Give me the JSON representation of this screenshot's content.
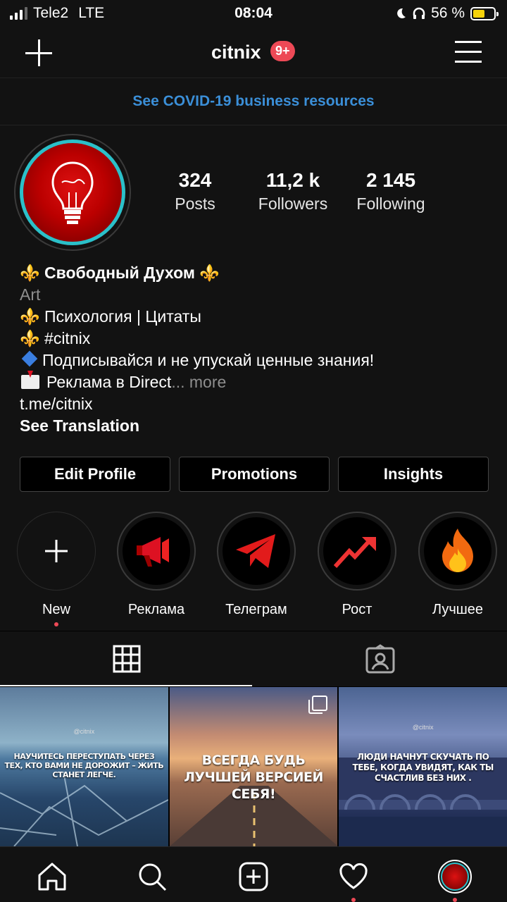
{
  "status_bar": {
    "carrier": "Tele2",
    "network": "LTE",
    "time": "08:04",
    "battery_percent": "56 %",
    "battery_level": 0.56
  },
  "header": {
    "username": "citnix",
    "notification_badge": "9+"
  },
  "banner": {
    "text": "See COVID-19 business resources"
  },
  "stats": [
    {
      "value": "324",
      "label": "Posts"
    },
    {
      "value": "11,2 k",
      "label": "Followers"
    },
    {
      "value": "2 145",
      "label": "Following"
    }
  ],
  "bio": {
    "fleur": "⚜️",
    "name": "Свободный Духом",
    "category": "Art",
    "line1": "Психология | Цитаты",
    "line2": "#citnix",
    "line3": "Подписывайся и не упускай ценные знания!",
    "line4": "Реклама в Direct",
    "ellipsis": "...",
    "more": "more",
    "link": "t.me/citnix",
    "see_translation": "See Translation"
  },
  "buttons": {
    "edit_profile": "Edit Profile",
    "promotions": "Promotions",
    "insights": "Insights"
  },
  "highlights": [
    {
      "label": "New"
    },
    {
      "label": "Реклама"
    },
    {
      "label": "Телеграм"
    },
    {
      "label": "Рост"
    },
    {
      "label": "Лучшее"
    }
  ],
  "posts": [
    {
      "watermark": "@citnix",
      "caption": "НАУЧИТЕСЬ ПЕРЕСТУПАТЬ ЧЕРЕЗ ТЕХ, КТО ВАМИ НЕ ДОРОЖИТ – ЖИТЬ СТАНЕТ ЛЕГЧЕ."
    },
    {
      "caption": "ВСЕГДА БУДЬ ЛУЧШЕЙ ВЕРСИЕЙ СЕБЯ!"
    },
    {
      "watermark": "@citnix",
      "caption": "ЛЮДИ НАЧНУТ СКУЧАТЬ ПО ТЕБЕ, КОГДА УВИДЯТ, КАК ТЫ СЧАСТЛИВ БЕЗ НИХ ."
    }
  ],
  "colors": {
    "accent_blue": "#3b8fd8",
    "badge_red": "#ed4956",
    "avatar_ring": "#2bc0c9",
    "battery_yellow": "#f5d20a"
  },
  "icons": {
    "header_left": "plus-icon",
    "header_right": "hamburger-menu-icon",
    "tab_grid": "grid-icon",
    "tab_tagged": "tagged-person-icon",
    "nav": [
      "home-icon",
      "search-icon",
      "add-post-icon",
      "heart-icon",
      "profile-avatar"
    ]
  }
}
